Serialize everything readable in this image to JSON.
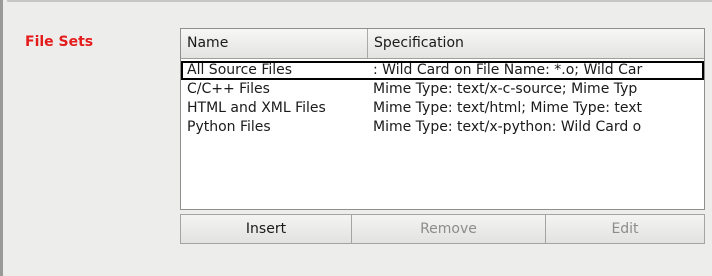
{
  "section": {
    "label": "File Sets",
    "label_color": "#e51c1c"
  },
  "table": {
    "columns": [
      "Name",
      "Specification"
    ],
    "selected_row": 0,
    "rows": [
      {
        "name": "All Source Files",
        "spec": ": Wild Card on File Name: *.o; Wild Car"
      },
      {
        "name": "C/C++ Files",
        "spec": "Mime Type: text/x-c-source; Mime Typ"
      },
      {
        "name": "HTML and XML Files",
        "spec": "Mime Type: text/html; Mime Type: text"
      },
      {
        "name": "Python Files",
        "spec": "Mime Type: text/x-python: Wild Card o"
      }
    ]
  },
  "buttons": {
    "insert": {
      "label": "Insert",
      "enabled": true
    },
    "remove": {
      "label": "Remove",
      "enabled": false
    },
    "edit": {
      "label": "Edit",
      "enabled": false
    }
  }
}
